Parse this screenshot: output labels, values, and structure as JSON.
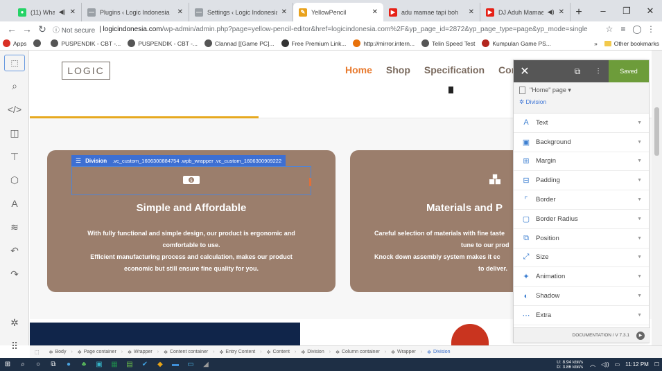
{
  "browser": {
    "tabs": [
      {
        "title": "(11) WhatsApp",
        "color": "#25d366",
        "glyph": "●",
        "speaker": true
      },
      {
        "title": "Plugins ‹ Logic Indonesia",
        "color": "#9aa0a6",
        "glyph": "—"
      },
      {
        "title": "Settings ‹ Logic Indonesia",
        "color": "#9aa0a6",
        "glyph": "—"
      },
      {
        "title": "YellowPencil",
        "color": "#e9a21c",
        "glyph": "✎",
        "active": true
      },
      {
        "title": "adu mamae tapi boh",
        "color": "#e62117",
        "glyph": "▶"
      },
      {
        "title": "DJ Aduh Mamae A",
        "color": "#e62117",
        "glyph": "▶",
        "speaker": true
      }
    ],
    "window_controls": [
      "–",
      "❐",
      "✕"
    ],
    "address": {
      "security": "Not secure",
      "host": "logicindonesia.com",
      "path": "/wp-admin/admin.php?page=yellow-pencil-editor&href=logicindonesia.com%2F&yp_page_id=2872&yp_page_type=page&yp_mode=single"
    },
    "bookmarks": [
      {
        "label": "Apps",
        "color": "#d93025"
      },
      {
        "label": "",
        "color": "#555"
      },
      {
        "label": "PUSPENDIK - CBT -...",
        "color": "#555"
      },
      {
        "label": "PUSPENDIK - CBT -...",
        "color": "#555"
      },
      {
        "label": "Clannad [[Game PC]...",
        "color": "#555"
      },
      {
        "label": "Free Premium Link...",
        "color": "#333"
      },
      {
        "label": "http://mirror.intern...",
        "color": "#e8710a"
      },
      {
        "label": "Telin Speed Test",
        "color": "#555"
      },
      {
        "label": "Kumpulan Game PS...",
        "color": "#b3261e"
      }
    ],
    "bookmarks_more": "»",
    "other_bookmarks": "Other bookmarks"
  },
  "left_tools": [
    {
      "name": "element-picker-icon",
      "glyph": "⬚"
    },
    {
      "name": "search-icon",
      "glyph": "⌕"
    },
    {
      "name": "code-icon",
      "glyph": "</>"
    },
    {
      "name": "responsive-icon",
      "glyph": "◫"
    },
    {
      "name": "measure-icon",
      "glyph": "⊤"
    },
    {
      "name": "cube-icon",
      "glyph": "⬡"
    },
    {
      "name": "typography-icon",
      "glyph": "A"
    },
    {
      "name": "animation-icon",
      "glyph": "≋"
    },
    {
      "name": "undo-icon",
      "glyph": "↶"
    },
    {
      "name": "redo-icon",
      "glyph": "↷"
    }
  ],
  "left_tools_bottom": [
    {
      "name": "settings-icon",
      "glyph": "✲"
    },
    {
      "name": "more-icon",
      "glyph": "⠿"
    }
  ],
  "site": {
    "logo": "LOGIC",
    "nav": [
      "Home",
      "Shop",
      "Specification",
      "Contac"
    ],
    "cards": [
      {
        "title": "Simple and Affordable",
        "lines": [
          "With fully functional and simple design, our product is ergonomic and",
          "comfortable to use.",
          "Efficient manufacturing process and calculation, makes our product",
          "economic but still ensure fine quality for you."
        ]
      },
      {
        "title": "Materials and P",
        "lines": [
          "Careful selection of materials with fine taste",
          "tune to our prod",
          "Knock down assembly system makes it ec",
          "to deliver."
        ]
      }
    ],
    "selection": {
      "label": "Division",
      "selector": ".vc_custom_1606300884754 .wpb_wrapper .vc_custom_1606300909222"
    }
  },
  "panel": {
    "saved_label": "Saved",
    "page_label": "\"Home\" page ▾",
    "element_label": "Division",
    "properties": [
      {
        "label": "Text",
        "icon": "A"
      },
      {
        "label": "Background",
        "icon": "▣"
      },
      {
        "label": "Margin",
        "icon": "⊞"
      },
      {
        "label": "Padding",
        "icon": "⊟"
      },
      {
        "label": "Border",
        "icon": "⌜"
      },
      {
        "label": "Border Radius",
        "icon": "▢"
      },
      {
        "label": "Position",
        "icon": "⧉"
      },
      {
        "label": "Size",
        "icon": "⤢"
      },
      {
        "label": "Animation",
        "icon": "✦"
      },
      {
        "label": "Shadow",
        "icon": "◐"
      },
      {
        "label": "Extra",
        "icon": "⋯"
      }
    ],
    "footer": "DOCUMENTATION / V 7.3.1"
  },
  "breadcrumbs": [
    "Body",
    "Page container",
    "Wrapper",
    "Content container",
    "Entry Content",
    "Content",
    "Division",
    "Column container",
    "Wrapper",
    "Division"
  ],
  "taskbar": {
    "net_up": "8.94 kbit/s",
    "net_down": "3.86 kbit/s",
    "net_up_label": "U:",
    "net_down_label": "D:",
    "time": "11:12 PM"
  }
}
